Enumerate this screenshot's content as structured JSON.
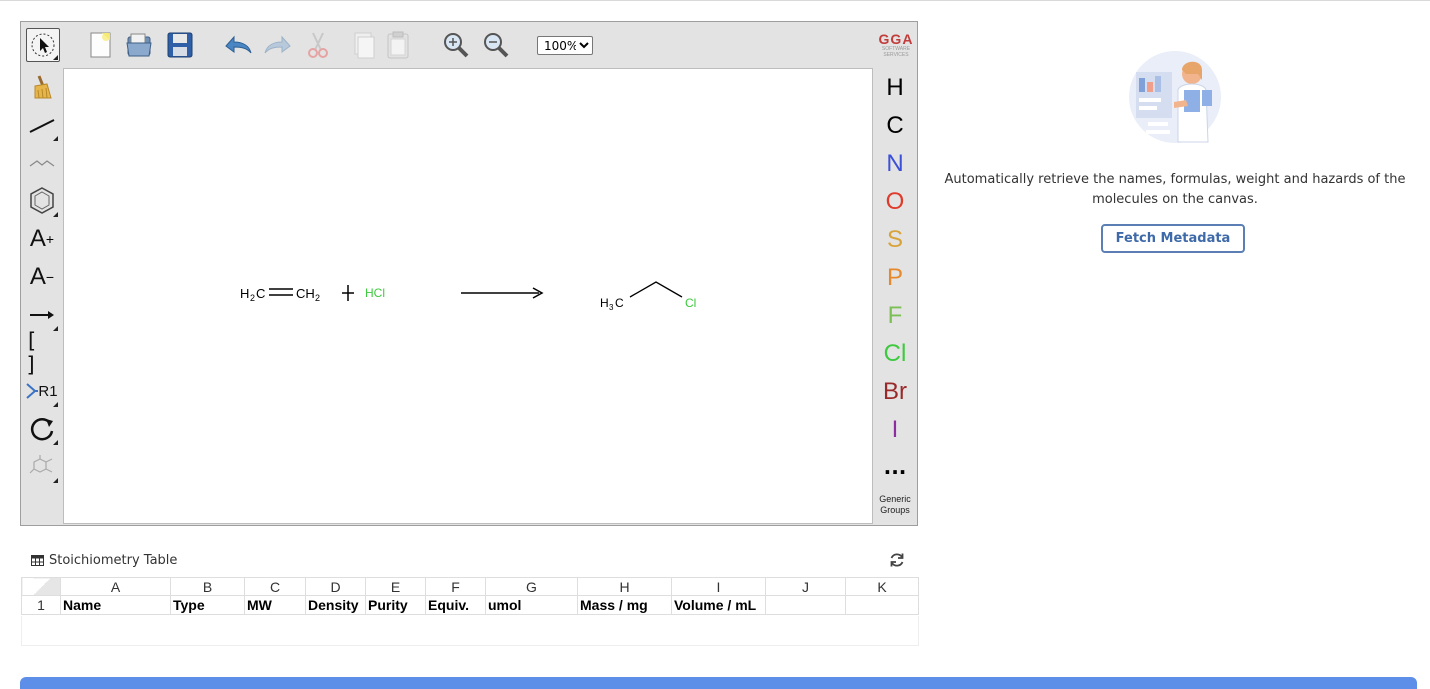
{
  "toolbar": {
    "zoom_options": [
      "100%"
    ],
    "zoom_value": "100%"
  },
  "logo": {
    "text": "GGA",
    "subtext": "SOFTWARE SERVICES"
  },
  "left_tools": {
    "increase_charge_label": "A",
    "increase_charge_sup": "+",
    "decrease_charge_label": "A",
    "decrease_charge_sup": "−",
    "brackets_label": "[ ]",
    "rgroup_label": "R1"
  },
  "elements": [
    {
      "symbol": "H",
      "color": "#000000"
    },
    {
      "symbol": "C",
      "color": "#000000"
    },
    {
      "symbol": "N",
      "color": "#3c50d8"
    },
    {
      "symbol": "O",
      "color": "#e03a2a"
    },
    {
      "symbol": "S",
      "color": "#d8a33a"
    },
    {
      "symbol": "P",
      "color": "#e5892c"
    },
    {
      "symbol": "F",
      "color": "#7cbf55"
    },
    {
      "symbol": "Cl",
      "color": "#3ec93e"
    },
    {
      "symbol": "Br",
      "color": "#9a2a2a"
    },
    {
      "symbol": "I",
      "color": "#8e2da0"
    }
  ],
  "more_elements_label": "...",
  "generic_groups_label": "Generic Groups",
  "reaction": {
    "reactant1_left": "H",
    "reactant1_left_sub": "2",
    "reactant1_left_c": "C",
    "reactant1_right": "CH",
    "reactant1_right_sub": "2",
    "reactant2": "HCl",
    "product_left": "H",
    "product_left_sub": "3",
    "product_left_c": "C",
    "product_right": "Cl"
  },
  "panel": {
    "description": "Automatically retrieve the names, formulas, weight and hazards of the molecules on the canvas.",
    "fetch_button": "Fetch Metadata"
  },
  "stoichiometry": {
    "title": "Stoichiometry Table",
    "columns": [
      "A",
      "B",
      "C",
      "D",
      "E",
      "F",
      "G",
      "H",
      "I",
      "J",
      "K"
    ],
    "row_number": "1",
    "row_cells": [
      "Name",
      "Type",
      "MW",
      "Density",
      "Purity",
      "Equiv.",
      "umol",
      "Mass / mg",
      "Volume / mL",
      "",
      ""
    ]
  }
}
